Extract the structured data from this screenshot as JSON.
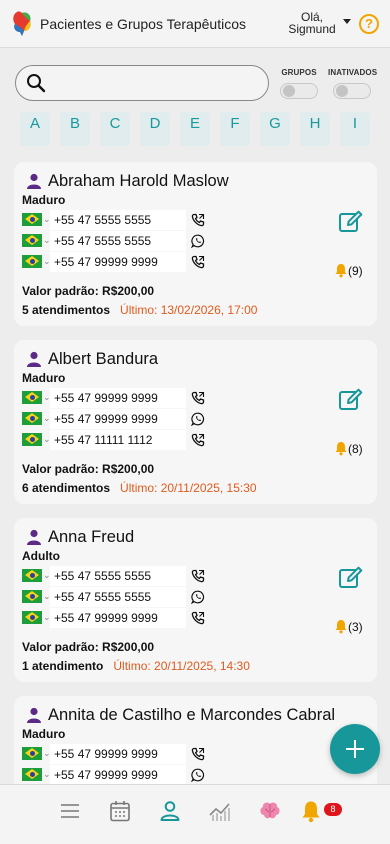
{
  "header": {
    "title": "Pacientes e Grupos Terapêuticos",
    "greeting_line1": "Olá,",
    "greeting_line2": "Sigmund",
    "help": "?"
  },
  "search": {
    "placeholder": "",
    "value": ""
  },
  "toggles": [
    {
      "label": "GRUPOS",
      "on": false
    },
    {
      "label": "INATIVADOS",
      "on": false
    }
  ],
  "alphabet": [
    "A",
    "B",
    "C",
    "D",
    "E",
    "F",
    "G",
    "H",
    "I"
  ],
  "patients": [
    {
      "name": "Abraham Harold Maslow",
      "category": "Maduro",
      "phones": [
        {
          "number": "+55 47 5555 5555",
          "icon": "phone-icon"
        },
        {
          "number": "+55 47 5555 5555",
          "icon": "whatsapp-icon"
        },
        {
          "number": "+55 47 99999 9999",
          "icon": "phone-icon"
        }
      ],
      "notifications": "(9)",
      "valor": "Valor padrão: R$200,00",
      "atendimentos": "5 atendimentos",
      "ultimo": "Último: 13/02/2026, 17:00"
    },
    {
      "name": "Albert Bandura",
      "category": "Maduro",
      "phones": [
        {
          "number": "+55 47 99999 9999",
          "icon": "phone-icon"
        },
        {
          "number": "+55 47 99999 9999",
          "icon": "whatsapp-icon"
        },
        {
          "number": "+55 47 11111 1112",
          "icon": "phone-icon"
        }
      ],
      "notifications": "(8)",
      "valor": "Valor padrão: R$200,00",
      "atendimentos": "6 atendimentos",
      "ultimo": "Último: 20/11/2025, 15:30"
    },
    {
      "name": "Anna Freud",
      "category": "Adulto",
      "phones": [
        {
          "number": "+55 47 5555 5555",
          "icon": "phone-icon"
        },
        {
          "number": "+55 47 5555 5555",
          "icon": "whatsapp-icon"
        },
        {
          "number": "+55 47 99999 9999",
          "icon": "phone-icon"
        }
      ],
      "notifications": "(3)",
      "valor": "Valor padrão: R$200,00",
      "atendimentos": "1 atendimento",
      "ultimo": "Último: 20/11/2025, 14:30"
    },
    {
      "name": "Annita de Castilho e Marcondes Cabral",
      "category": "Maduro",
      "phones": [
        {
          "number": "+55 47 99999 9999",
          "icon": "phone-icon"
        },
        {
          "number": "+55 47 99999 9999",
          "icon": "whatsapp-icon"
        }
      ],
      "notifications": "",
      "valor": "",
      "atendimentos": "",
      "ultimo": ""
    }
  ],
  "nav": {
    "items": [
      "menu-icon",
      "calendar-icon",
      "patients-icon",
      "chart-icon",
      "brain-icon",
      "bell-icon"
    ],
    "active": "patients-icon",
    "badge": "8"
  },
  "colors": {
    "accent": "#18979a",
    "alert": "#e25a1c",
    "person": "#5b2a86",
    "bell": "#f0a500"
  }
}
